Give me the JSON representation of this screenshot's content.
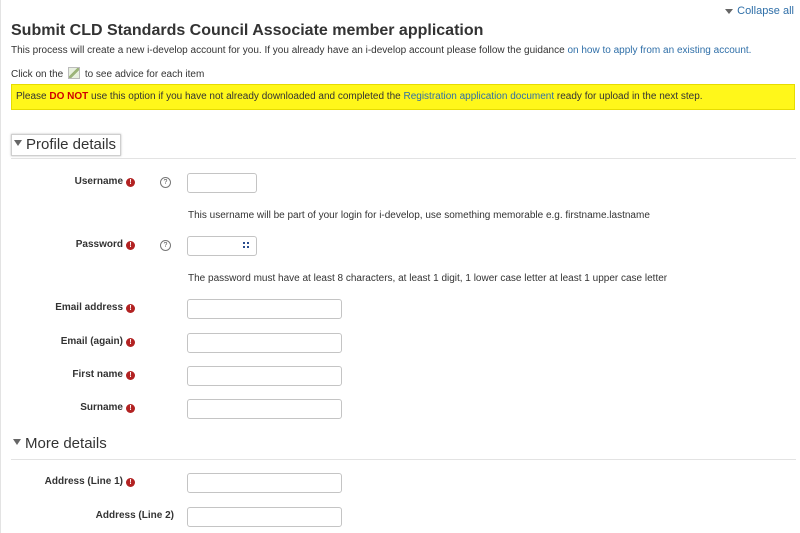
{
  "header": {
    "collapse_all": "Collapse all",
    "title": "Submit CLD Standards Council Associate member application"
  },
  "intro": {
    "text": "This process will create a new i-develop account for you. If you already have an i-develop account please follow the guidance ",
    "link": "on how to apply from an existing account."
  },
  "advice": {
    "before": "Click on the",
    "after": "to see advice for each item"
  },
  "notice": {
    "before": "Please ",
    "strong": "DO NOT",
    "middle": " use this option if you have not already downloaded and completed the ",
    "link": "Registration application document",
    "after": " ready for upload in the next step.",
    "color": "#fff71a"
  },
  "profile": {
    "legend": "Profile details",
    "username": {
      "label": "Username",
      "value": "",
      "hint": "This username will be part of your login for i-develop, use something memorable e.g. firstname.lastname"
    },
    "password": {
      "label": "Password",
      "value": "",
      "hint": "The password must have at least 8 characters, at least 1 digit, 1 lower case letter at least 1 upper case letter"
    },
    "email": {
      "label": "Email address",
      "value": ""
    },
    "email_again": {
      "label": "Email (again)",
      "value": ""
    },
    "first_name": {
      "label": "First name",
      "value": ""
    },
    "surname": {
      "label": "Surname",
      "value": ""
    }
  },
  "more": {
    "legend": "More details",
    "address1": {
      "label": "Address (Line 1)",
      "value": ""
    },
    "address2": {
      "label": "Address (Line 2)",
      "value": ""
    }
  },
  "icons": {
    "required": "required-icon",
    "help": "help-icon",
    "collapse": "chevron-down-icon"
  },
  "colors": {
    "link": "#2f6fa8",
    "required": "#b22222",
    "warning_text": "#d00000"
  }
}
